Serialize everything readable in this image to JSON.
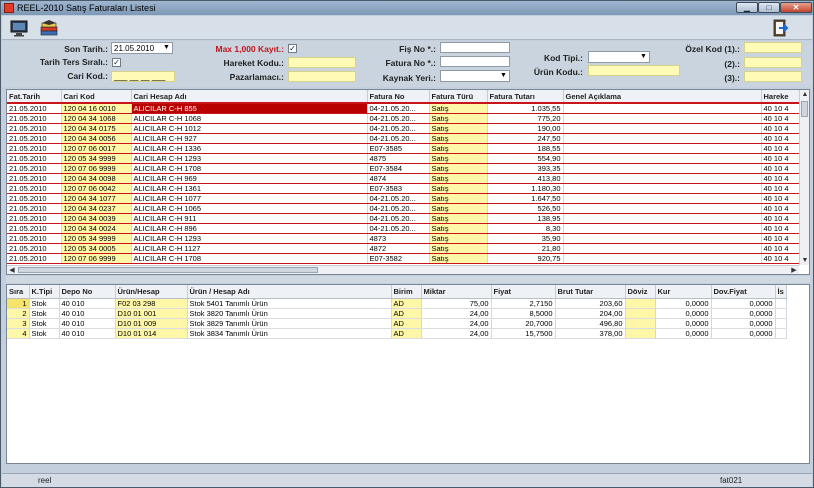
{
  "window": {
    "title": "REEL-2010 Satış Faturaları Listesi",
    "min_label": "▁",
    "max_label": "□",
    "close_label": "✕"
  },
  "filters": {
    "son_tarih_label": "Son Tarih.:",
    "son_tarih_value": "21.05.2010",
    "tarih_ters_label": "Tarih Ters Sıralı.:",
    "tarih_ters_checked": "✓",
    "cari_kod_label": "Cari Kod.:",
    "cari_kod_value": "___ __ __ ___",
    "max_kayit_label": "Max 1,000 Kayıt.:",
    "max_kayit_checked": "✓",
    "hareket_kodu_label": "Hareket Kodu.:",
    "pazarlamaci_label": "Pazarlamacı.:",
    "fis_no_label": "Fiş No *.:",
    "fatura_no_label": "Fatura No *.:",
    "kaynak_yeri_label": "Kaynak Yeri.:",
    "kod_tipi_label": "Kod Tipi.:",
    "urun_kodu_label": "Ürün Kodu.:",
    "ozel_kod1_label": "Özel Kod (1).:",
    "ozel_kod2_label": "(2).:",
    "ozel_kod3_label": "(3).:"
  },
  "invoices": {
    "headers": [
      "Fat.Tarih",
      "Cari Kod",
      "Cari Hesap Adı",
      "Fatura No",
      "Fatura Türü",
      "Fatura Tutarı",
      "Genel Açıklama",
      "Hareke"
    ],
    "rows": [
      [
        "21.05.2010",
        "120 04 16 0010",
        "ALICILAR C-H 855",
        "04-21.05.20...",
        "Satış",
        "1.035,55",
        "",
        "40 10 4"
      ],
      [
        "21.05.2010",
        "120 04 34 1068",
        "ALICILAR C-H 1068",
        "04-21.05.20...",
        "Satış",
        "775,20",
        "",
        "40 10 4"
      ],
      [
        "21.05.2010",
        "120 04 34 0175",
        "ALICILAR C-H 1012",
        "04-21.05.20...",
        "Satış",
        "190,00",
        "",
        "40 10 4"
      ],
      [
        "21.05.2010",
        "120 04 34 0056",
        "ALICILAR C-H 927",
        "04-21.05.20...",
        "Satış",
        "247,50",
        "",
        "40 10 4"
      ],
      [
        "21.05.2010",
        "120 07 06 0017",
        "ALICILAR C-H 1336",
        "E07-3585",
        "Satış",
        "188,55",
        "",
        "40 10 4"
      ],
      [
        "21.05.2010",
        "120 05 34 9999",
        "ALICILAR C-H 1293",
        "4875",
        "Satış",
        "554,90",
        "",
        "40 10 4"
      ],
      [
        "21.05.2010",
        "120 07 06 9999",
        "ALICILAR C-H 1708",
        "E07-3584",
        "Satış",
        "393,35",
        "",
        "40 10 4"
      ],
      [
        "21.05.2010",
        "120 04 34 0098",
        "ALICILAR C-H 969",
        "4874",
        "Satış",
        "413,80",
        "",
        "40 10 4"
      ],
      [
        "21.05.2010",
        "120 07 06 0042",
        "ALICILAR C-H 1361",
        "E07-3583",
        "Satış",
        "1.180,30",
        "",
        "40 10 4"
      ],
      [
        "21.05.2010",
        "120 04 34 1077",
        "ALICILAR C-H 1077",
        "04-21.05.20...",
        "Satış",
        "1.647,50",
        "",
        "40 10 4"
      ],
      [
        "21.05.2010",
        "120 04 34 0237",
        "ALICILAR C-H 1065",
        "04-21.05.20...",
        "Satış",
        "526,50",
        "",
        "40 10 4"
      ],
      [
        "21.05.2010",
        "120 04 34 0039",
        "ALICILAR C-H 911",
        "04-21.05.20...",
        "Satış",
        "138,95",
        "",
        "40 10 4"
      ],
      [
        "21.05.2010",
        "120 04 34 0024",
        "ALICILAR C-H 896",
        "04-21.05.20...",
        "Satış",
        "8,30",
        "",
        "40 10 4"
      ],
      [
        "21.05.2010",
        "120 05 34 9999",
        "ALICILAR C-H 1293",
        "4873",
        "Satış",
        "35,90",
        "",
        "40 10 4"
      ],
      [
        "21.05.2010",
        "120 05 34 0005",
        "ALICILAR C-H 1127",
        "4872",
        "Satış",
        "21,80",
        "",
        "40 10 4"
      ],
      [
        "21.05.2010",
        "120 07 06 9999",
        "ALICILAR C-H 1708",
        "E07-3582",
        "Satış",
        "920,75",
        "",
        "40 10 4"
      ]
    ]
  },
  "lines": {
    "headers": [
      "Sıra",
      "K.Tipi",
      "Depo No",
      "Ürün/Hesap",
      "Ürün / Hesap Adı",
      "Birim",
      "Miktar",
      "Fiyat",
      "Brut Tutar",
      "Döviz",
      "Kur",
      "Dov.Fiyat",
      "İs"
    ],
    "rows": [
      [
        "1",
        "Stok",
        "40 010",
        "F02 03 298",
        "Stok 5401 Tanımlı Ürün",
        "AD",
        "75,00",
        "2,7150",
        "203,60",
        "",
        "0,0000",
        "0,0000",
        ""
      ],
      [
        "2",
        "Stok",
        "40 010",
        "D10 01 001",
        "Stok 3820 Tanımlı Ürün",
        "AD",
        "24,00",
        "8,5000",
        "204,00",
        "",
        "0,0000",
        "0,0000",
        ""
      ],
      [
        "3",
        "Stok",
        "40 010",
        "D10 01 009",
        "Stok 3829 Tanımlı Ürün",
        "AD",
        "24,00",
        "20,7000",
        "496,80",
        "",
        "0,0000",
        "0,0000",
        ""
      ],
      [
        "4",
        "Stok",
        "40 010",
        "D10 01 014",
        "Stok 3834 Tanımlı Ürün",
        "AD",
        "24,00",
        "15,7500",
        "378,00",
        "",
        "0,0000",
        "0,0000",
        ""
      ]
    ]
  },
  "statusbar": {
    "user": "reel",
    "form": "fat021"
  }
}
